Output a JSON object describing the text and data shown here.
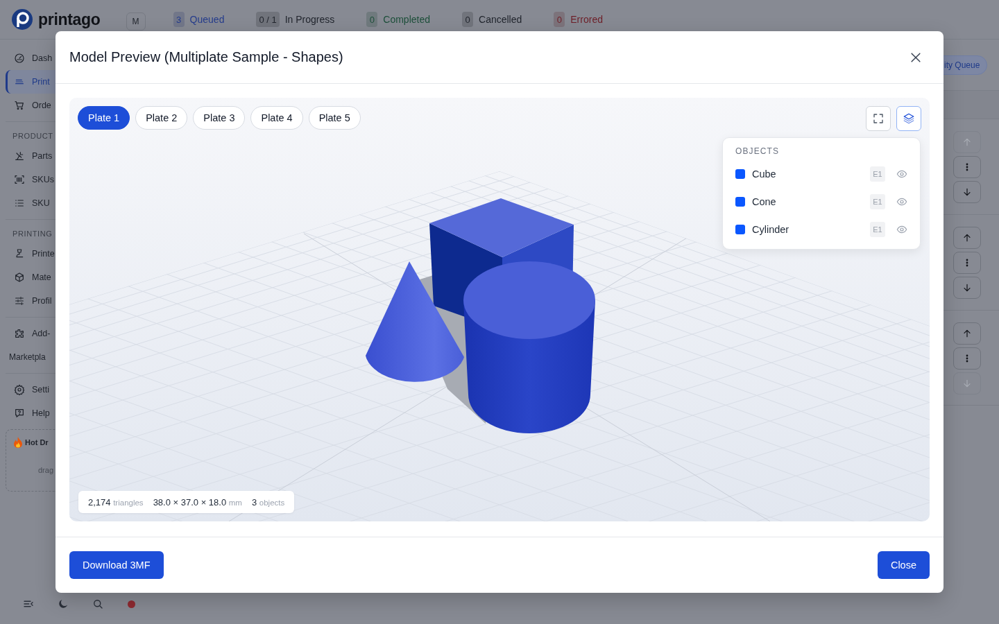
{
  "app": {
    "logo": "printago",
    "user_badge": "M",
    "status_counts": [
      {
        "count": "3",
        "label": "Queued",
        "color": "#253c8c"
      },
      {
        "count": "0 / 1",
        "label": "In Progress",
        "color": "#22262e"
      },
      {
        "count": "0",
        "label": "Completed",
        "color": "#1d4f3a"
      },
      {
        "count": "0",
        "label": "Cancelled",
        "color": "#22262e"
      },
      {
        "count": "0",
        "label": "Errored",
        "color": "#6e1f28"
      }
    ],
    "sidebar": [
      {
        "kind": "item",
        "label": "Dash",
        "selected": false
      },
      {
        "kind": "item",
        "label": "Print",
        "selected": true
      },
      {
        "kind": "item",
        "label": "Orde",
        "selected": false
      },
      {
        "kind": "heading",
        "label": "PRODUCT"
      },
      {
        "kind": "item",
        "label": "Parts",
        "selected": false
      },
      {
        "kind": "item",
        "label": "SKUs",
        "selected": false
      },
      {
        "kind": "item",
        "label": "SKU",
        "selected": false
      },
      {
        "kind": "heading",
        "label": "PRINTING"
      },
      {
        "kind": "item",
        "label": "Printe",
        "selected": false
      },
      {
        "kind": "item",
        "label": "Mate",
        "selected": false
      },
      {
        "kind": "item",
        "label": "Profil",
        "selected": false
      },
      {
        "kind": "divider"
      },
      {
        "kind": "item",
        "label": "Add-",
        "selected": false
      },
      {
        "kind": "plain",
        "label": "Marketpla",
        "selected": false
      },
      {
        "kind": "divider"
      },
      {
        "kind": "item",
        "label": "Setti",
        "selected": false
      },
      {
        "kind": "item",
        "label": "Help",
        "selected": false
      }
    ],
    "hot_drop": {
      "title": "Hot Dr",
      "hint": "drag"
    },
    "queue_button": "ity Queue",
    "queue_rows": [
      {
        "up_disabled": true,
        "down_disabled": false
      },
      {
        "up_disabled": false,
        "down_disabled": false
      },
      {
        "up_disabled": false,
        "down_disabled": true
      }
    ]
  },
  "modal": {
    "title": "Model Preview (Multiplate Sample - Shapes)",
    "plates": [
      {
        "label": "Plate 1",
        "selected": true
      },
      {
        "label": "Plate 2",
        "selected": false
      },
      {
        "label": "Plate 3",
        "selected": false
      },
      {
        "label": "Plate 4",
        "selected": false
      },
      {
        "label": "Plate 5",
        "selected": false
      }
    ],
    "layers_open": true,
    "objects_heading": "OBJECTS",
    "objects": [
      {
        "name": "Cube",
        "color": "#0a57ff",
        "extruder": "E1",
        "visible": true
      },
      {
        "name": "Cone",
        "color": "#0a57ff",
        "extruder": "E1",
        "visible": true
      },
      {
        "name": "Cylinder",
        "color": "#0a57ff",
        "extruder": "E1",
        "visible": true
      }
    ],
    "stats": [
      {
        "value": "2,174",
        "unit": "triangles"
      },
      {
        "value": "38.0 × 37.0 × 18.0",
        "unit": "mm"
      },
      {
        "value": "3",
        "unit": "objects"
      }
    ],
    "download_button": "Download 3MF",
    "close_button": "Close"
  }
}
